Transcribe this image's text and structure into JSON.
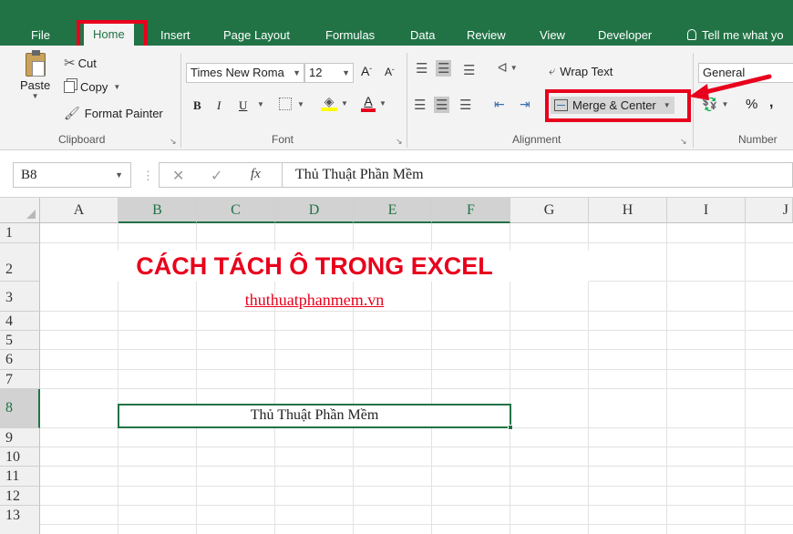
{
  "tabs": [
    {
      "label": "File"
    },
    {
      "label": "Home"
    },
    {
      "label": "Insert"
    },
    {
      "label": "Page Layout"
    },
    {
      "label": "Formulas"
    },
    {
      "label": "Data"
    },
    {
      "label": "Review"
    },
    {
      "label": "View"
    },
    {
      "label": "Developer"
    }
  ],
  "tell_me": "Tell me what yo",
  "clipboard": {
    "paste": "Paste",
    "cut": "Cut",
    "copy": "Copy",
    "format_painter": "Format Painter",
    "group_label": "Clipboard"
  },
  "font": {
    "name": "Times New Roma",
    "size": "12",
    "bold": "B",
    "italic": "I",
    "underline": "U",
    "group_label": "Font"
  },
  "alignment": {
    "wrap_text": "Wrap Text",
    "merge_center": "Merge & Center",
    "group_label": "Alignment"
  },
  "number": {
    "format": "General",
    "percent": "%",
    "comma": ",",
    "group_label": "Number"
  },
  "formula_bar": {
    "name_box": "B8",
    "fx": "fx",
    "content": "Thủ Thuật Phần Mềm"
  },
  "columns": [
    "A",
    "B",
    "C",
    "D",
    "E",
    "F",
    "G",
    "H",
    "I",
    "J"
  ],
  "rows": [
    "1",
    "2",
    "3",
    "4",
    "5",
    "6",
    "7",
    "8",
    "9",
    "10",
    "11",
    "12",
    "13"
  ],
  "cells": {
    "title": "CÁCH TÁCH Ô TRONG EXCEL",
    "link": "thuthuatphanmem.vn",
    "b8": "Thủ Thuật Phần Mềm"
  },
  "colors": {
    "excel_green": "#217346",
    "highlight_red": "#e8001c"
  }
}
